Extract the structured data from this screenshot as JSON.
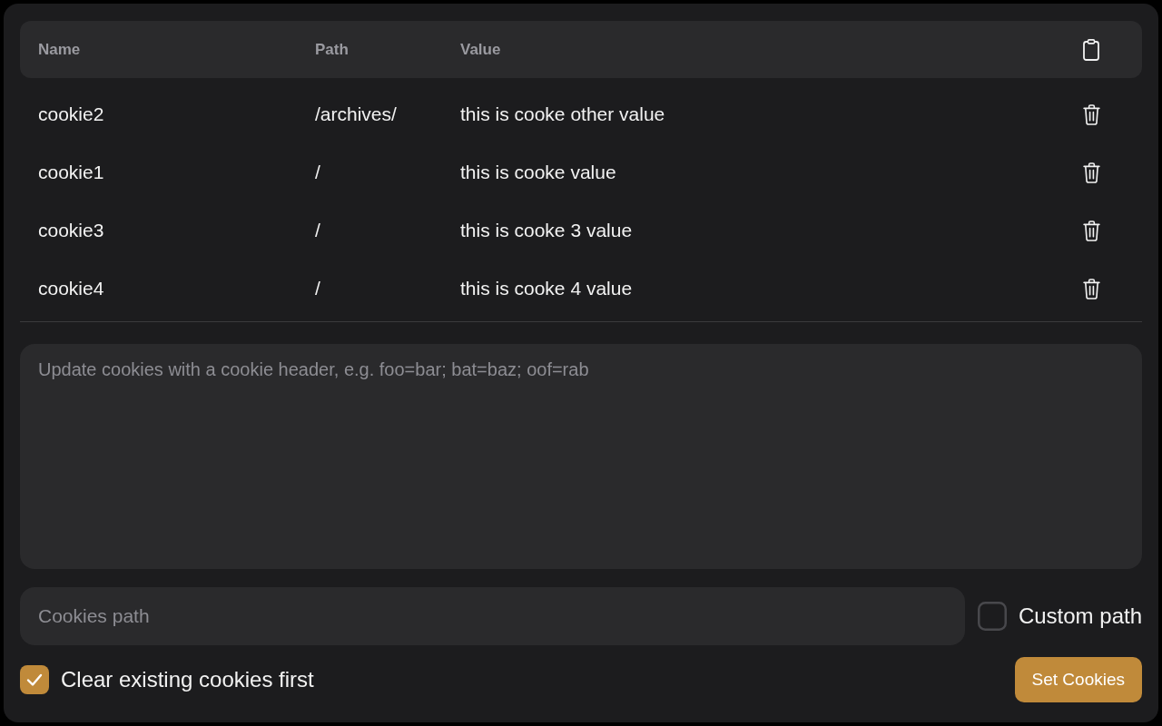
{
  "table": {
    "columns": [
      "Name",
      "Path",
      "Value"
    ],
    "rows": [
      {
        "name": "cookie2",
        "path": "/archives/",
        "value": "this is cooke other value"
      },
      {
        "name": "cookie1",
        "path": "/",
        "value": "this is cooke value"
      },
      {
        "name": "cookie3",
        "path": "/",
        "value": "this is cooke 3 value"
      },
      {
        "name": "cookie4",
        "path": "/",
        "value": "this is cooke 4 value"
      }
    ]
  },
  "cookie_header_field": {
    "placeholder": "Update cookies with a cookie header, e.g. foo=bar; bat=baz; oof=rab"
  },
  "path_field": {
    "placeholder": "Cookies path"
  },
  "custom_path": {
    "label": "Custom path",
    "checked": false
  },
  "clear_existing": {
    "label": "Clear existing cookies first",
    "checked": true
  },
  "set_button": {
    "label": "Set Cookies"
  }
}
